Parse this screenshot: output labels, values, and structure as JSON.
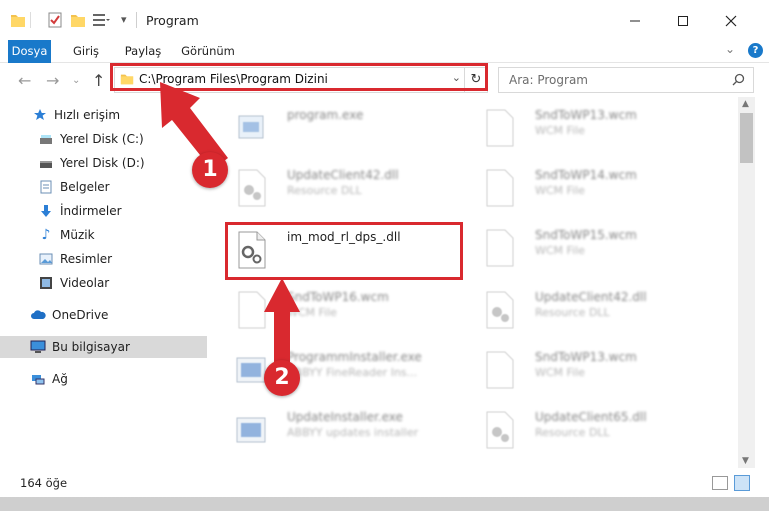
{
  "titlebar": {
    "title": "Program"
  },
  "ribbon": {
    "tabs": [
      "Dosya",
      "Giriş",
      "Paylaş",
      "Görünüm"
    ],
    "help": "?"
  },
  "address": {
    "path": "C:\\Program Files\\Program Dizini"
  },
  "search": {
    "placeholder": "Ara: Program"
  },
  "sidebar": {
    "items": [
      {
        "label": "Hızlı erişim",
        "icon": "star-icon",
        "pinned": false
      },
      {
        "label": "Yerel Disk (C:)",
        "icon": "drive-icon",
        "pinned": true
      },
      {
        "label": "Yerel Disk (D:)",
        "icon": "drive-icon",
        "pinned": true
      },
      {
        "label": "Belgeler",
        "icon": "document-icon",
        "pinned": true
      },
      {
        "label": "İndirmeler",
        "icon": "download-icon",
        "pinned": true
      },
      {
        "label": "Müzik",
        "icon": "music-icon",
        "pinned": true
      },
      {
        "label": "Resimler",
        "icon": "pictures-icon",
        "pinned": true
      },
      {
        "label": "Videolar",
        "icon": "video-icon",
        "pinned": true
      },
      {
        "label": "OneDrive",
        "icon": "cloud-icon",
        "pinned": false
      },
      {
        "label": "Bu bilgisayar",
        "icon": "computer-icon",
        "pinned": false,
        "selected": true
      },
      {
        "label": "Ağ",
        "icon": "network-icon",
        "pinned": false
      }
    ]
  },
  "files": [
    {
      "name": "program.exe",
      "desc": "",
      "icon": "exe-icon"
    },
    {
      "name": "UpdateClient42.dll",
      "desc": "Resource DLL",
      "icon": "dll-icon"
    },
    {
      "name": "im_mod_rl_dps_.dll",
      "desc": "",
      "icon": "dll-icon"
    },
    {
      "name": "SndToWP16.wcm",
      "desc": "WCM File",
      "icon": "file-icon"
    },
    {
      "name": "ProgrammInstaller.exe",
      "desc": "ABBYY FineReader Ins...",
      "icon": "exe-icon"
    },
    {
      "name": "UpdateInstaller.exe",
      "desc": "ABBYY updates installer",
      "icon": "exe-icon"
    },
    {
      "name": "SndToWP13.wcm",
      "desc": "WCM File",
      "icon": "file-icon"
    },
    {
      "name": "SndToWP14.wcm",
      "desc": "WCM File",
      "icon": "file-icon"
    },
    {
      "name": "SndToWP15.wcm",
      "desc": "WCM File",
      "icon": "file-icon"
    },
    {
      "name": "UpdateClient42.dll",
      "desc": "Resource DLL",
      "icon": "dll-icon"
    },
    {
      "name": "SndToWP13.wcm",
      "desc": "WCM File",
      "icon": "file-icon"
    },
    {
      "name": "UpdateClient65.dll",
      "desc": "Resource DLL",
      "icon": "dll-icon"
    }
  ],
  "status": {
    "count": "164 öğe"
  },
  "annotations": {
    "step1": "1",
    "step2": "2"
  },
  "colors": {
    "accent": "#1979ca",
    "annotation": "#d9292f"
  }
}
